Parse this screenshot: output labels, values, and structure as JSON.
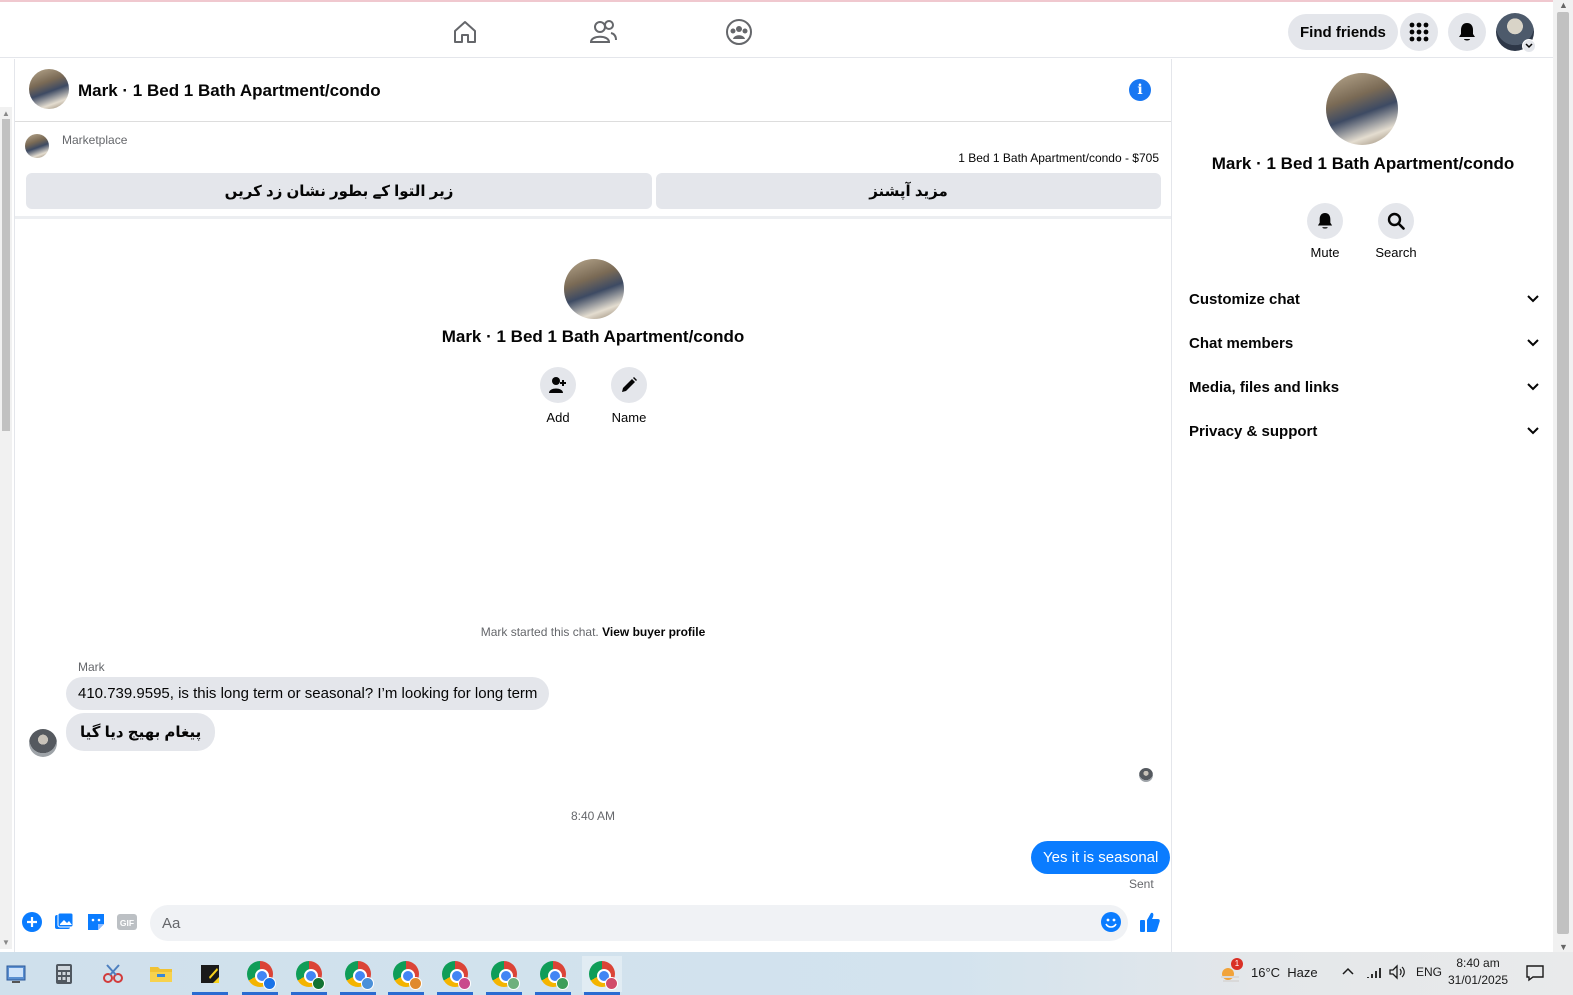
{
  "topnav": {
    "find_friends": "Find friends"
  },
  "chat": {
    "title": "Mark · 1 Bed 1 Bath Apartment/condo",
    "marketplace_label": "Marketplace",
    "listing": "1 Bed 1 Bath Apartment/condo - $705",
    "btn_mark_pending": "زیر التوا کے بطور نشان زد کریں",
    "btn_more_options": "مزید آپشنز",
    "center_name": "Mark · 1 Bed 1 Bath Apartment/condo",
    "add_label": "Add",
    "name_label": "Name",
    "started_text": "Mark started this chat.",
    "view_buyer_profile": "View buyer profile",
    "sender_name": "Mark",
    "messages": [
      {
        "text": "410.739.9595, is this long term or seasonal? I’m looking for long term"
      },
      {
        "text": "پیغام بھیج دیا گیا"
      }
    ],
    "timestamp": "8:40 AM",
    "my_message": "Yes it is seasonal",
    "sent_status": "Sent",
    "composer_placeholder": "Aa",
    "gif_label": "GIF"
  },
  "info_panel": {
    "name": "Mark · 1 Bed 1 Bath Apartment/condo",
    "mute_label": "Mute",
    "search_label": "Search",
    "sections": [
      "Customize chat",
      "Chat members",
      "Media, files and links",
      "Privacy & support"
    ]
  },
  "taskbar": {
    "weather": "16°C  Haze",
    "weather_badge": "1",
    "lang": "ENG",
    "time": "8:40 am",
    "date": "31/01/2025"
  },
  "colors": {
    "accent": "#0a7cff",
    "brand_blue": "#1877f2",
    "bubble_gray": "#e4e6eb"
  }
}
